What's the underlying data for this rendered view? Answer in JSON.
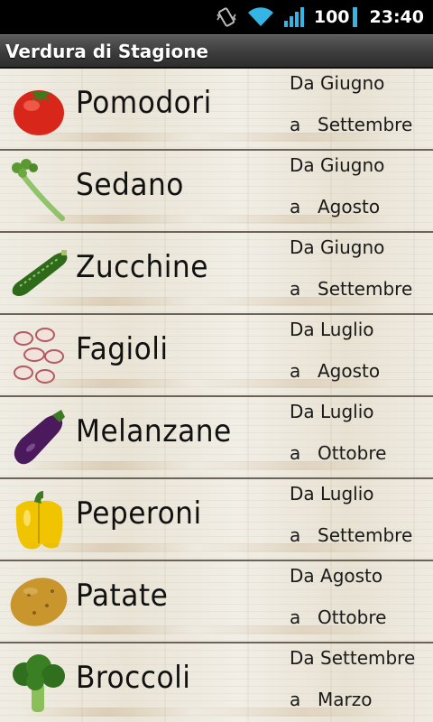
{
  "status_bar": {
    "battery": "100",
    "time": "23:40",
    "icons": [
      "vibrate-icon",
      "wifi-icon",
      "signal-icon",
      "battery-icon"
    ]
  },
  "app": {
    "title": "Verdura di Stagione"
  },
  "colors": {
    "accent": "#33b5e5",
    "wood": "#ebe7dc",
    "divider": "#6b6357"
  },
  "vegetables": [
    {
      "name": "Pomodori",
      "from": "Da Giugno",
      "to_prefix": "a",
      "to": "Settembre",
      "icon": "tomato-icon"
    },
    {
      "name": "Sedano",
      "from": "Da Giugno",
      "to_prefix": "a",
      "to": "Agosto",
      "icon": "celery-icon"
    },
    {
      "name": "Zucchine",
      "from": "Da Giugno",
      "to_prefix": "a",
      "to": "Settembre",
      "icon": "zucchini-icon"
    },
    {
      "name": "Fagioli",
      "from": "Da Luglio",
      "to_prefix": "a",
      "to": "Agosto",
      "icon": "beans-icon"
    },
    {
      "name": "Melanzane",
      "from": "Da Luglio",
      "to_prefix": "a",
      "to": "Ottobre",
      "icon": "eggplant-icon"
    },
    {
      "name": "Peperoni",
      "from": "Da Luglio",
      "to_prefix": "a",
      "to": "Settembre",
      "icon": "pepper-icon"
    },
    {
      "name": "Patate",
      "from": "Da Agosto",
      "to_prefix": "a",
      "to": "Ottobre",
      "icon": "potato-icon"
    },
    {
      "name": "Broccoli",
      "from": "Da Settembre",
      "to_prefix": "a",
      "to": "Marzo",
      "icon": "broccoli-icon"
    }
  ]
}
